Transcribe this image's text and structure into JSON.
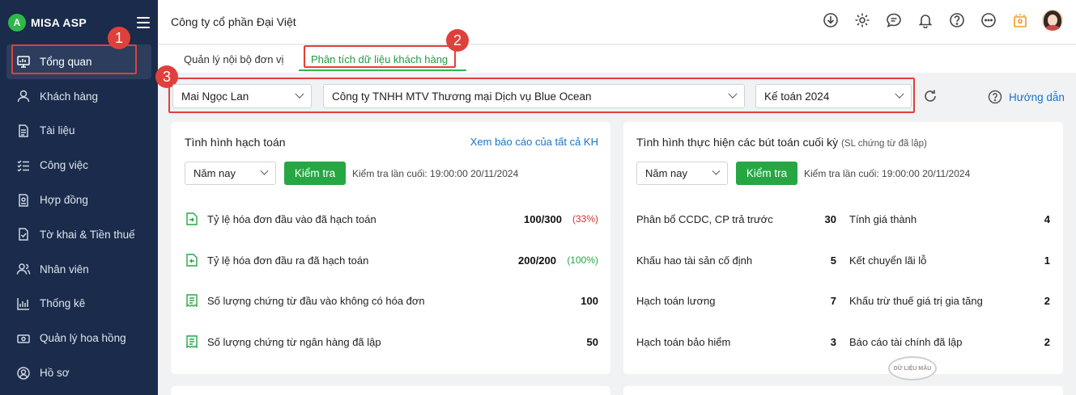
{
  "app": {
    "logo_text": "MISA ASP",
    "logo_mark": "A"
  },
  "sidebar": {
    "items": [
      {
        "label": "Tổng quan",
        "icon": "monitor-icon"
      },
      {
        "label": "Khách hàng",
        "icon": "user-icon"
      },
      {
        "label": "Tài liệu",
        "icon": "document-icon"
      },
      {
        "label": "Công việc",
        "icon": "checklist-icon"
      },
      {
        "label": "Hợp đồng",
        "icon": "contract-icon"
      },
      {
        "label": "Tờ khai & Tiền thuế",
        "icon": "tax-declaration-icon"
      },
      {
        "label": "Nhân viên",
        "icon": "employees-icon"
      },
      {
        "label": "Thống kê",
        "icon": "statistics-icon"
      },
      {
        "label": "Quản lý hoa hồng",
        "icon": "commission-icon"
      },
      {
        "label": "Hồ sơ",
        "icon": "profile-icon"
      }
    ]
  },
  "header": {
    "company": "Công ty cổ phần Đại Việt"
  },
  "tabs": [
    {
      "label": "Quản lý nội bộ đơn vị"
    },
    {
      "label": "Phân tích dữ liệu khách hàng"
    }
  ],
  "filters": {
    "employee": "Mai Ngọc Lan",
    "customer": "Công ty TNHH MTV Thương mại Dịch vụ Blue Ocean",
    "period": "Kế toán 2024",
    "guide": "Hướng dẫn"
  },
  "annotations": [
    "1",
    "2",
    "3"
  ],
  "card_left": {
    "title": "Tình hình hạch toán",
    "link": "Xem báo cáo của tất cả KH",
    "period": "Năm nay",
    "button": "Kiểm tra",
    "last_check": "Kiểm tra lần cuối: 19:00:00 20/11/2024",
    "rows": [
      {
        "label": "Tỷ lệ hóa đơn đầu vào đã hạch toán",
        "value": "100/300",
        "pct": "(33%)"
      },
      {
        "label": "Tỷ lệ hóa đơn đầu ra đã hạch toán",
        "value": "200/200",
        "pct": "(100%)"
      },
      {
        "label": "Số lượng chứng từ đầu vào không có hóa đơn",
        "value": "100"
      },
      {
        "label": "Số lượng chứng từ ngân hàng đã lập",
        "value": "50"
      }
    ]
  },
  "card_right": {
    "title": "Tình hình thực hiện các bút toán cuối kỳ",
    "subtitle": "(SL chứng từ đã lập)",
    "period": "Năm nay",
    "button": "Kiểm tra",
    "last_check": "Kiểm tra lần cuối: 19:00:00 20/11/2024",
    "left_col": [
      {
        "label": "Phân bổ CCDC, CP trả trước",
        "value": "30"
      },
      {
        "label": "Khấu hao tài sản cố định",
        "value": "5"
      },
      {
        "label": "Hạch toán lương",
        "value": "7"
      },
      {
        "label": "Hạch toán bảo hiểm",
        "value": "3"
      }
    ],
    "right_col": [
      {
        "label": "Tính giá thành",
        "value": "4"
      },
      {
        "label": "Kết chuyển lãi lỗ",
        "value": "1"
      },
      {
        "label": "Khấu trừ thuế giá trị gia tăng",
        "value": "2"
      },
      {
        "label": "Báo cáo tài chính đã lập",
        "value": "2"
      }
    ]
  },
  "watermark": "DỮ LIỆU MẪU",
  "colors": {
    "sidebar": "#1a2b4b",
    "accent_green": "#26a743",
    "link_blue": "#1a73c9",
    "annotation_red": "#e0403b"
  }
}
